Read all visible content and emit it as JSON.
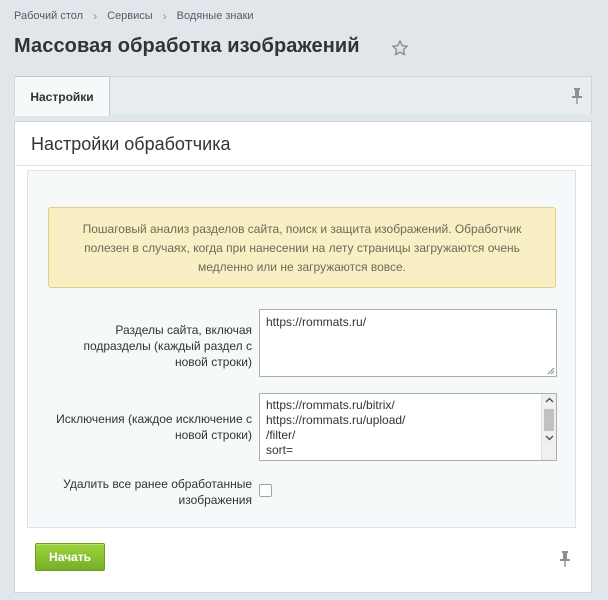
{
  "breadcrumb": {
    "items": [
      "Рабочий стол",
      "Сервисы",
      "Водяные знаки"
    ]
  },
  "page": {
    "title": "Массовая обработка изображений"
  },
  "tabs": [
    {
      "label": "Настройки",
      "active": true
    }
  ],
  "panel": {
    "title": "Настройки обработчика"
  },
  "notice": {
    "text": "Пошаговый анализ разделов сайта, поиск и защита изображений. Обработчик полезен в случаях, когда при нанесении на лету страницы загружаются очень медленно или не загружаются вовсе."
  },
  "form": {
    "sections": {
      "label": "Разделы сайта, включая подразделы (каждый раздел с новой строки)",
      "value": "https://rommats.ru/"
    },
    "exceptions": {
      "label": "Исключения (каждое исключение с новой строки)",
      "lines": [
        "https://rommats.ru/bitrix/",
        "https://rommats.ru/upload/",
        "/filter/",
        "sort="
      ]
    },
    "delete_processed": {
      "label": "Удалить все ранее обработанные изображения",
      "checked": false
    }
  },
  "actions": {
    "start_label": "Начать"
  },
  "colors": {
    "page_bg": "#e0e6e9",
    "notice_bg": "#f8efc5",
    "start_button": "#86c133"
  }
}
